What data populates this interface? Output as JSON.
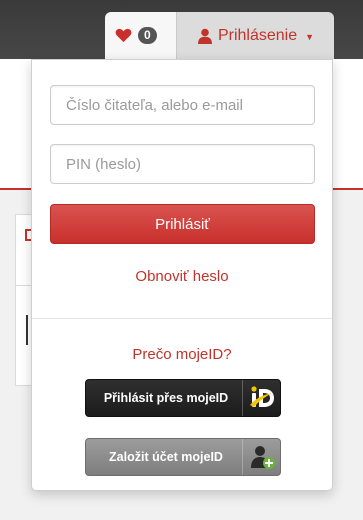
{
  "header": {
    "favorites_count": "0",
    "login_label": "Prihlásenie"
  },
  "login_form": {
    "username_placeholder": "Číslo čitateľa, alebo e-mail",
    "pin_placeholder": "PIN (heslo)",
    "submit_label": "Prihlásiť",
    "reset_link": "Obnoviť heslo",
    "mojeid_question": "Prečo mojeID?",
    "mojeid_login_label": "Přihlásit přes mojeID",
    "mojeid_register_label": "Založit účet mojeID"
  },
  "icons": {
    "favorites": "heart-icon",
    "user": "user-icon",
    "caret": "caret-down-icon",
    "mojeid_logo": "mojeid-logo-icon",
    "mojeid_add_user": "add-user-icon"
  },
  "colors": {
    "accent": "#c9302c",
    "topbar": "#404040",
    "mojeid_dark": "#222222",
    "mojeid_gray": "#8c8c8c",
    "mojeid_yellow": "#f5c400",
    "mojeid_green": "#6cb33e"
  }
}
